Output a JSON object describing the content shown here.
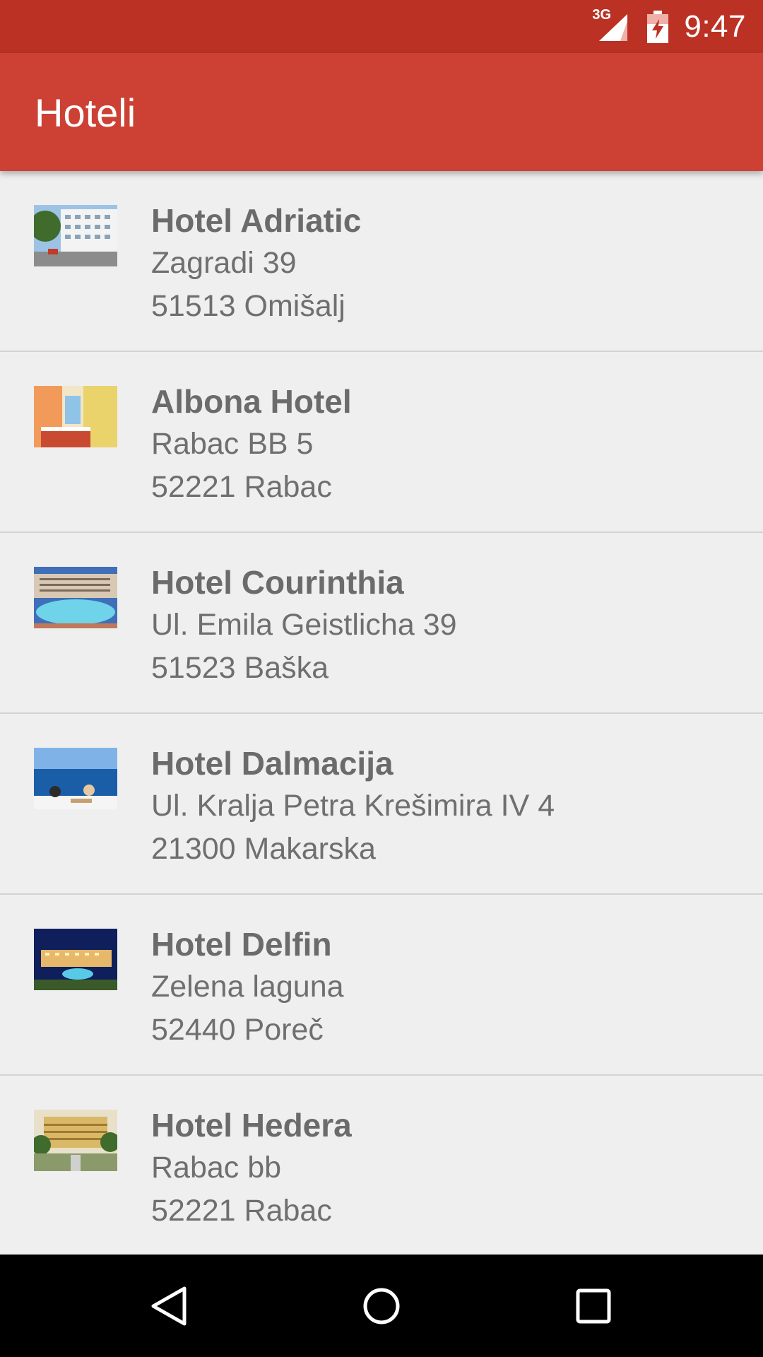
{
  "status_bar": {
    "time": "9:47",
    "network_type": "3G",
    "icons": [
      "signal-icon",
      "battery-charging-icon"
    ]
  },
  "app_bar": {
    "title": "Hoteli",
    "color": "#cc4134",
    "status_color": "#bb3224"
  },
  "hotels": [
    {
      "name": "Hotel Adriatic",
      "address": "Zagradi 39",
      "city": "51513 Omišalj"
    },
    {
      "name": "Albona Hotel",
      "address": "Rabac BB 5",
      "city": "52221 Rabac"
    },
    {
      "name": "Hotel Courinthia",
      "address": "Ul. Emila Geistlicha 39",
      "city": "51523 Baška"
    },
    {
      "name": "Hotel Dalmacija",
      "address": "Ul. Kralja Petra Krešimira IV 4",
      "city": "21300 Makarska"
    },
    {
      "name": "Hotel Delfin",
      "address": "Zelena laguna",
      "city": "52440 Poreč"
    },
    {
      "name": "Hotel Hedera",
      "address": "Rabac bb",
      "city": "52221 Rabac"
    }
  ],
  "nav_bar": {
    "icons": [
      "back-icon",
      "home-icon",
      "recent-apps-icon"
    ]
  }
}
